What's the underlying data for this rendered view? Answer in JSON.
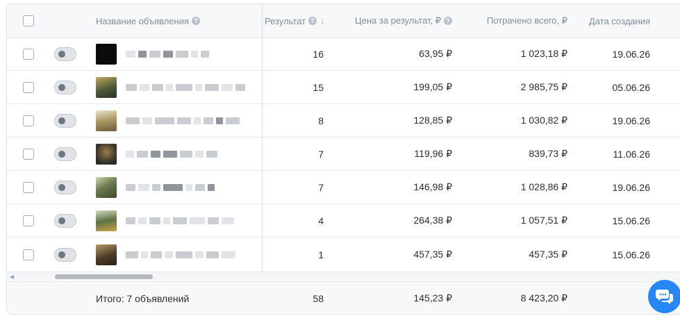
{
  "header": {
    "name_label": "Название объявления",
    "result_label": "Результат",
    "sort_arrow": "↓",
    "price_label": "Цена за результат, ₽",
    "spent_label": "Потрачено всего, ₽",
    "date_label": "Дата создания"
  },
  "rows": [
    {
      "result": "16",
      "price": "63,95 ₽",
      "spent": "1 023,18 ₽",
      "date": "19.06.26",
      "thumb_color": "#0b0b0b"
    },
    {
      "result": "15",
      "price": "199,05 ₽",
      "spent": "2 985,75 ₽",
      "date": "05.06.26",
      "thumb_color": "#4a5a3a"
    },
    {
      "result": "8",
      "price": "128,85 ₽",
      "spent": "1 030,82 ₽",
      "date": "19.06.26",
      "thumb_color": "#a99660"
    },
    {
      "result": "7",
      "price": "119,96 ₽",
      "spent": "839,73 ₽",
      "date": "11.06.26",
      "thumb_color": "#3b3a2c"
    },
    {
      "result": "7",
      "price": "146,98 ₽",
      "spent": "1 028,86 ₽",
      "date": "19.06.26",
      "thumb_color": "#6a7b4f"
    },
    {
      "result": "4",
      "price": "264,38 ₽",
      "spent": "1 057,51 ₽",
      "date": "15.06.26",
      "thumb_color": "#5c7244"
    },
    {
      "result": "1",
      "price": "457,35 ₽",
      "spent": "457,35 ₽",
      "date": "15.06.26",
      "thumb_color": "#4e3d2a"
    }
  ],
  "footer": {
    "total_label": "Итого: 7 объявлений",
    "result": "58",
    "price": "145,23 ₽",
    "spent": "8 423,20 ₽"
  },
  "icons": {
    "help": "question-circle-icon",
    "chat": "chat-bubbles-icon"
  },
  "colors": {
    "accent": "#2787f5",
    "header_bg": "#f7f8fa",
    "border": "#dce1e6"
  }
}
